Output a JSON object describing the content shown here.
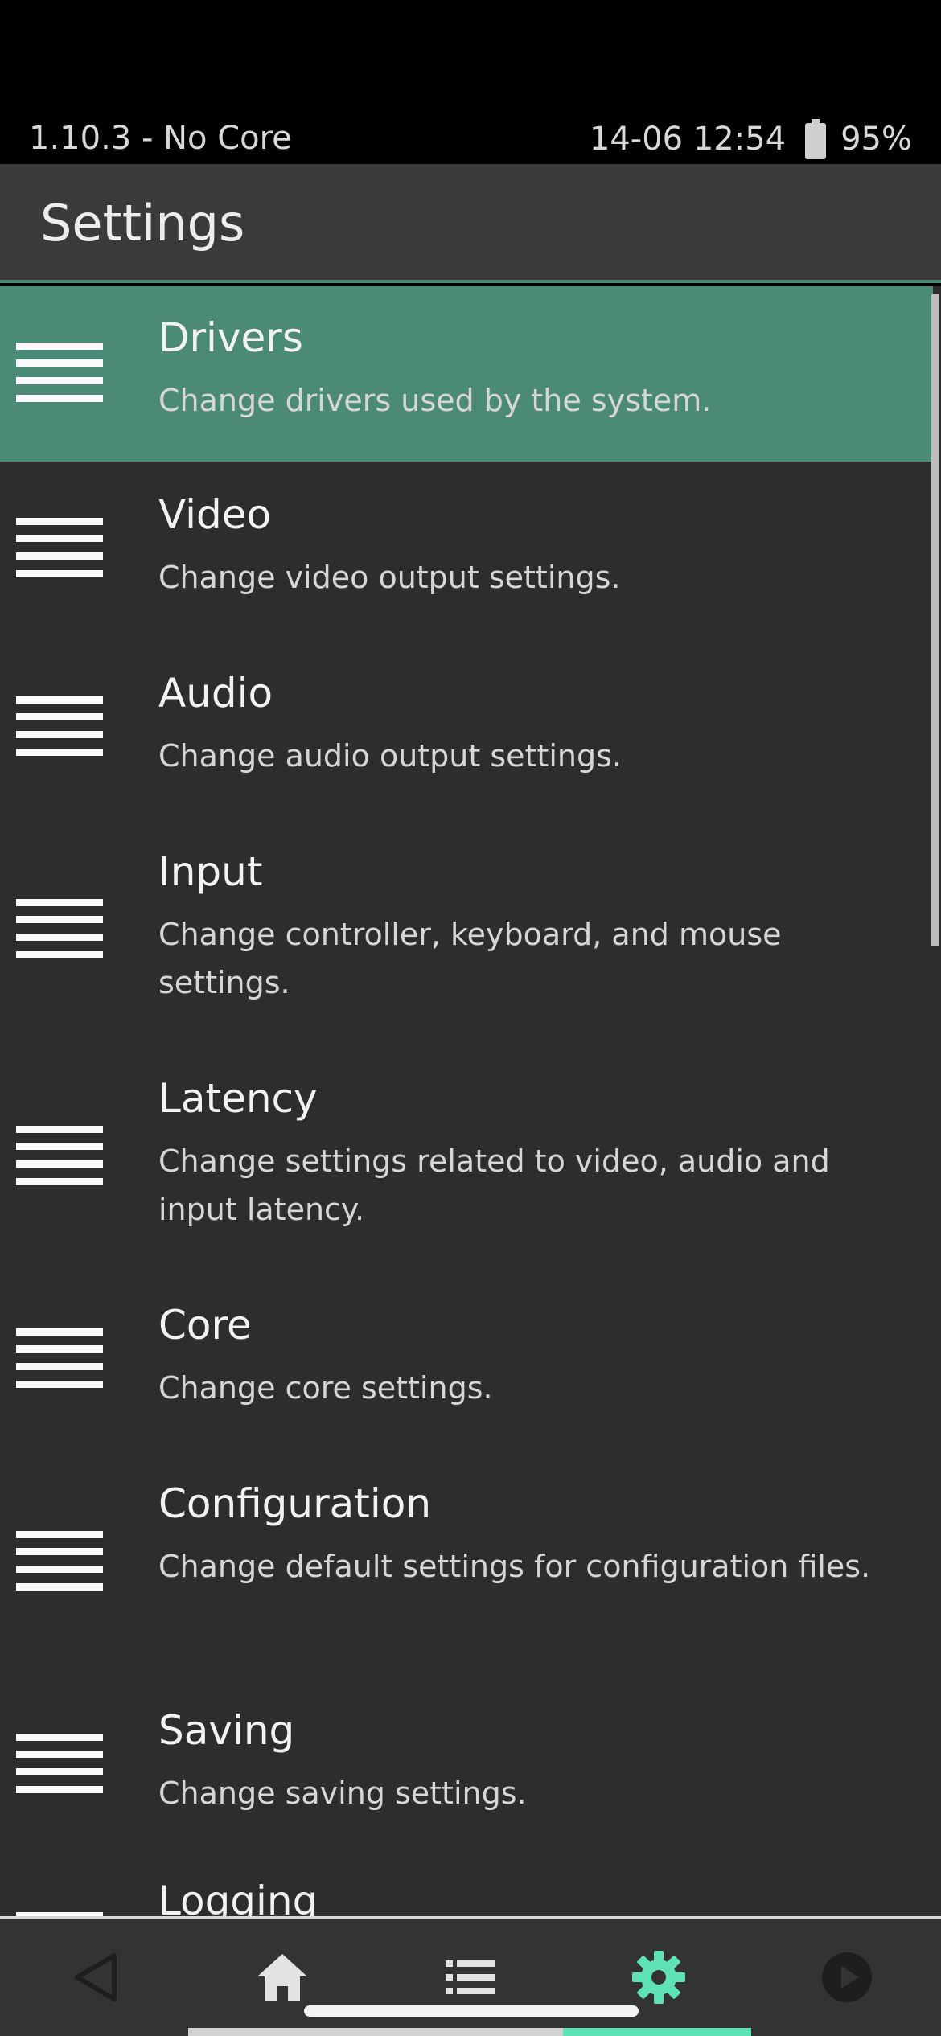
{
  "status_bar": {
    "left_text": "1.10.3 - No Core",
    "datetime": "14-06 12:54",
    "battery": "95%",
    "battery_icon": "battery-icon"
  },
  "header": {
    "title": "Settings"
  },
  "colors": {
    "selected_row": "#4b8a76",
    "accent": "#5fe3b6",
    "list_background": "#2d2d2d",
    "header_background": "#3a3a3a"
  },
  "menu": {
    "selected_index": 0,
    "items": [
      {
        "title": "Drivers",
        "description": "Change drivers used by the system."
      },
      {
        "title": "Video",
        "description": "Change video output settings."
      },
      {
        "title": "Audio",
        "description": "Change audio output settings."
      },
      {
        "title": "Input",
        "description": "Change controller, keyboard, and mouse settings."
      },
      {
        "title": "Latency",
        "description": "Change settings related to video, audio and input latency."
      },
      {
        "title": "Core",
        "description": "Change core settings."
      },
      {
        "title": "Configuration",
        "description": "Change default settings for configuration files."
      },
      {
        "title": "Saving",
        "description": "Change saving settings."
      },
      {
        "title": "Logging",
        "description": ""
      }
    ]
  },
  "bottom_nav": {
    "items": [
      {
        "icon": "back-triangle-icon",
        "active": false
      },
      {
        "icon": "home-icon",
        "active": false
      },
      {
        "icon": "list-icon",
        "active": false
      },
      {
        "icon": "gear-icon",
        "active": true
      },
      {
        "icon": "play-icon",
        "active": false
      }
    ],
    "active_tab_fill": 0.333
  }
}
